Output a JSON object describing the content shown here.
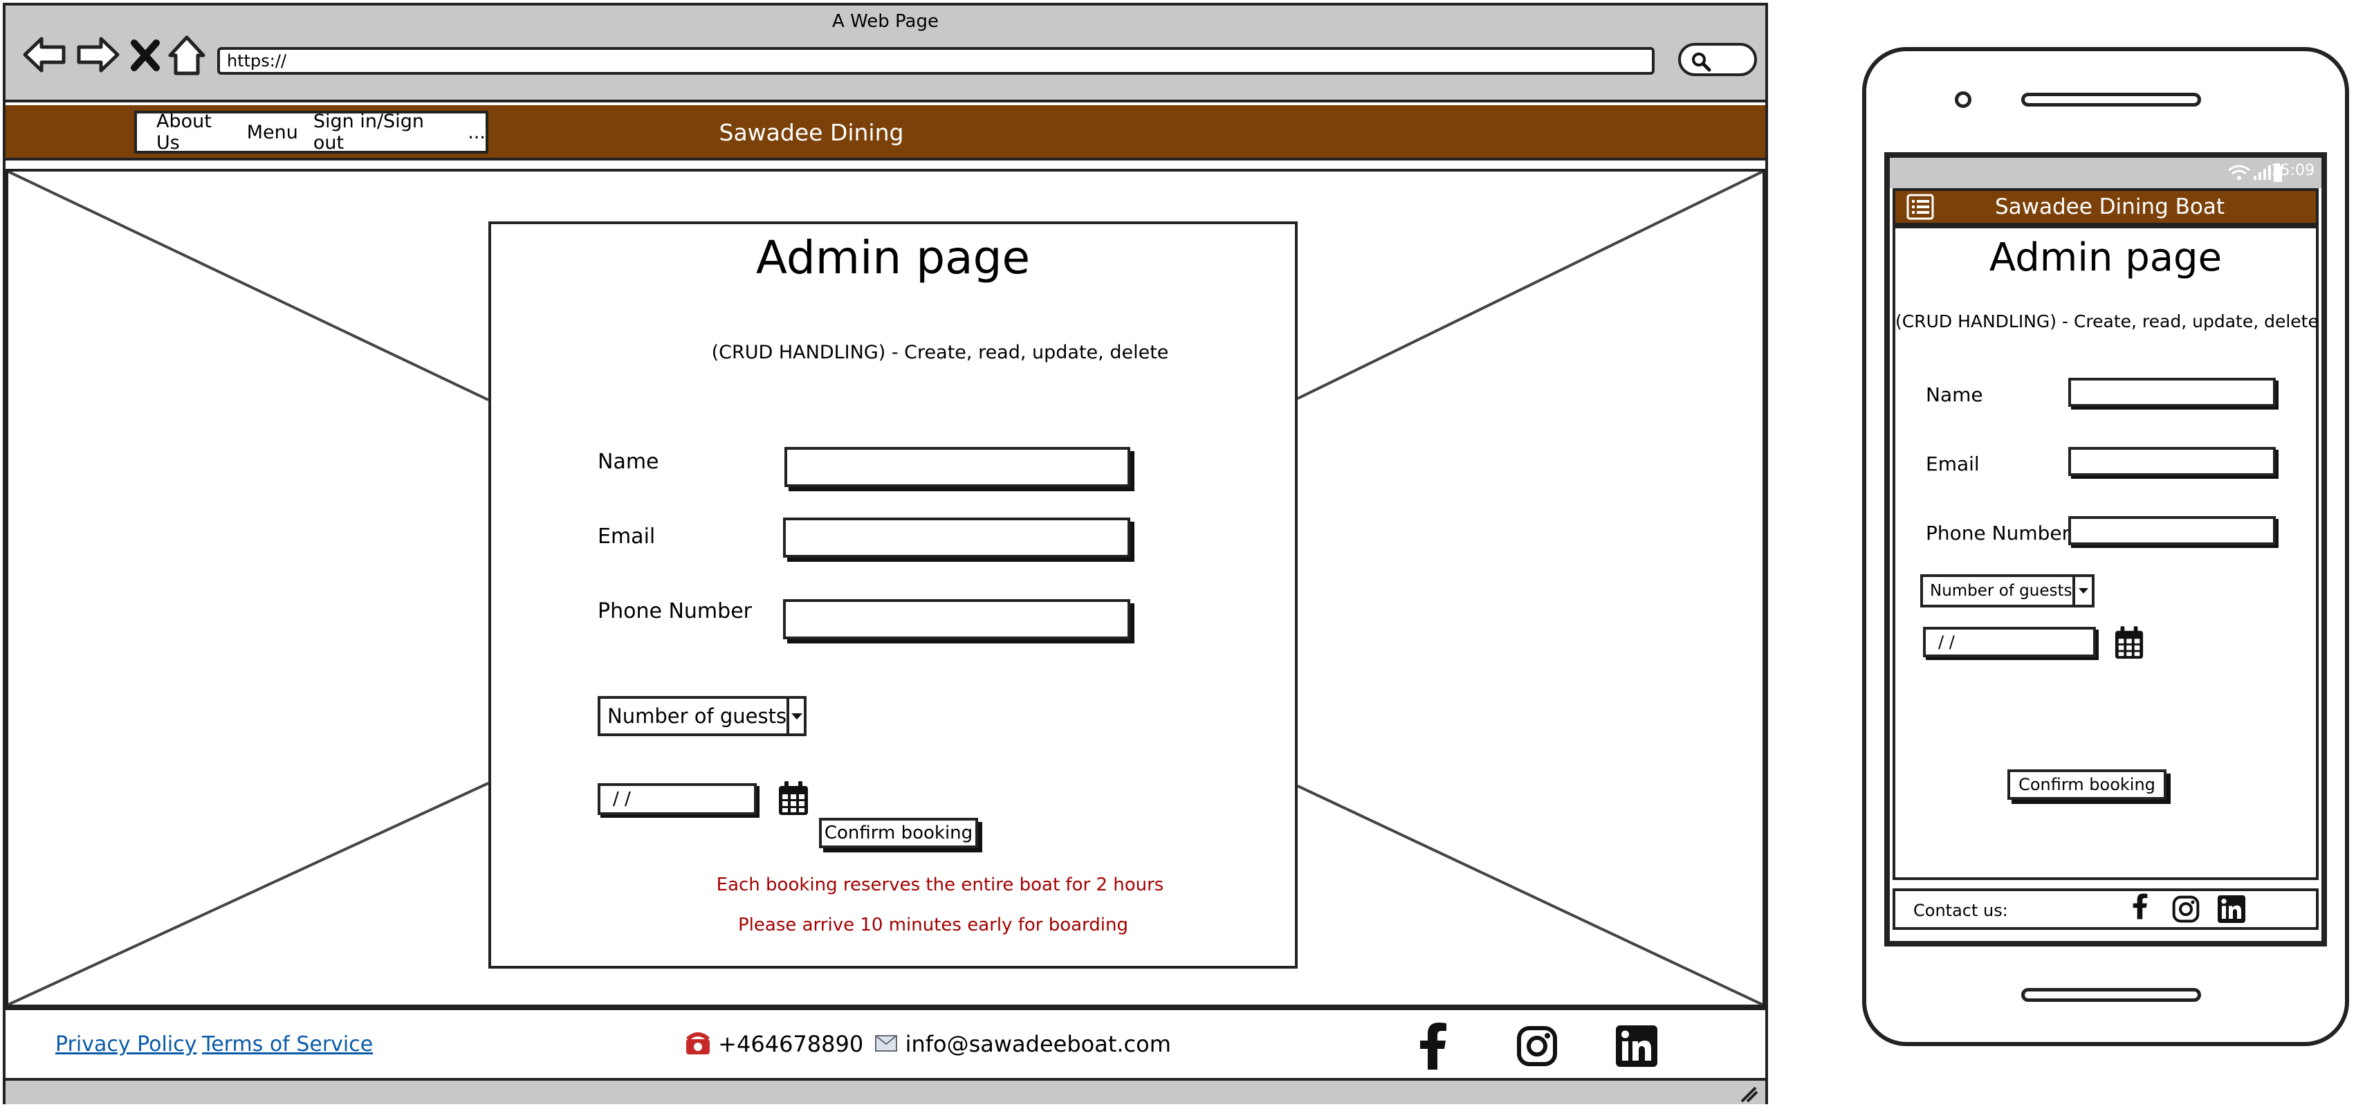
{
  "browser": {
    "window_title": "A Web Page",
    "url": "https://"
  },
  "site": {
    "brand": "Sawadee Dining Boat",
    "brand_color": "#7b4109",
    "nav_items": [
      "About Us",
      "Menu",
      "Sign in/Sign out",
      "..."
    ]
  },
  "admin_form": {
    "title": "Admin page",
    "subtitle": "(CRUD HANDLING) - Create, read, update, delete",
    "name_label": "Name",
    "email_label": "Email",
    "phone_label": "Phone Number",
    "guests_select": "Number of guests",
    "date_placeholder": "/ /",
    "confirm_button": "Confirm booking",
    "note_1": "Each booking reserves the entire boat for 2 hours",
    "note_2": "Please arrive 10 minutes early for boarding",
    "note_color": "#a30000"
  },
  "footer": {
    "privacy": "Privacy Policy",
    "terms": "Terms of Service",
    "phone": "+464678890",
    "email": "info@sawadeeboat.com",
    "social_icons": [
      "facebook-icon",
      "instagram-icon",
      "linkedin-icon"
    ]
  },
  "mobile": {
    "time": "15:09",
    "brand": "Sawadee Dining Boat",
    "title": "Admin page",
    "subtitle": "(CRUD HANDLING) - Create, read, update, delete",
    "name_label": "Name",
    "email_label": "Email",
    "phone_label": "Phone Number",
    "guests_select": "Number of guests",
    "date_placeholder": "/ /",
    "confirm_button": "Confirm booking",
    "contact_label": "Contact us:"
  }
}
